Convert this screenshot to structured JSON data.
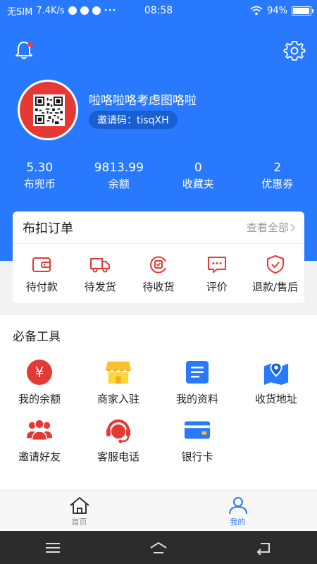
{
  "status_bar": {
    "carrier": "无SIM",
    "net_speed": "7.4K/s",
    "time": "08:58",
    "battery": "94%"
  },
  "header": {
    "bell_icon": "bell-icon",
    "settings_icon": "gear-icon"
  },
  "user": {
    "name": "啦咯啦咯考虑图咯啦",
    "invite_code": "邀请码：tisqXH"
  },
  "stats": [
    {
      "value": "5.30",
      "label": "布兜币"
    },
    {
      "value": "9813.99",
      "label": "余额"
    },
    {
      "value": "0",
      "label": "收藏夹"
    },
    {
      "value": "2",
      "label": "优惠券"
    }
  ],
  "orders": {
    "title": "布扣订单",
    "view_all": "查看全部",
    "items": [
      {
        "label": "待付款",
        "icon": "wallet-icon"
      },
      {
        "label": "待发货",
        "icon": "truck-icon"
      },
      {
        "label": "待收货",
        "icon": "receive-icon"
      },
      {
        "label": "评价",
        "icon": "comment-icon"
      },
      {
        "label": "退款/售后",
        "icon": "shield-icon"
      }
    ]
  },
  "tools": {
    "title": "必备工具",
    "items": [
      {
        "label": "我的余额",
        "icon": "yen-icon"
      },
      {
        "label": "商家入驻",
        "icon": "shop-icon"
      },
      {
        "label": "我的资料",
        "icon": "document-icon"
      },
      {
        "label": "收货地址",
        "icon": "map-pin-icon"
      },
      {
        "label": "邀请好友",
        "icon": "friends-icon"
      },
      {
        "label": "客服电话",
        "icon": "headset-icon"
      },
      {
        "label": "银行卡",
        "icon": "bank-card-icon"
      }
    ]
  },
  "tabbar": {
    "items": [
      {
        "label": "首页",
        "icon": "home-icon",
        "active": false
      },
      {
        "label": "我的",
        "icon": "user-icon",
        "active": true
      }
    ]
  },
  "colors": {
    "brand_blue": "#2979ff",
    "accent_red": "#e53935",
    "accent_yellow": "#fbc02d"
  }
}
